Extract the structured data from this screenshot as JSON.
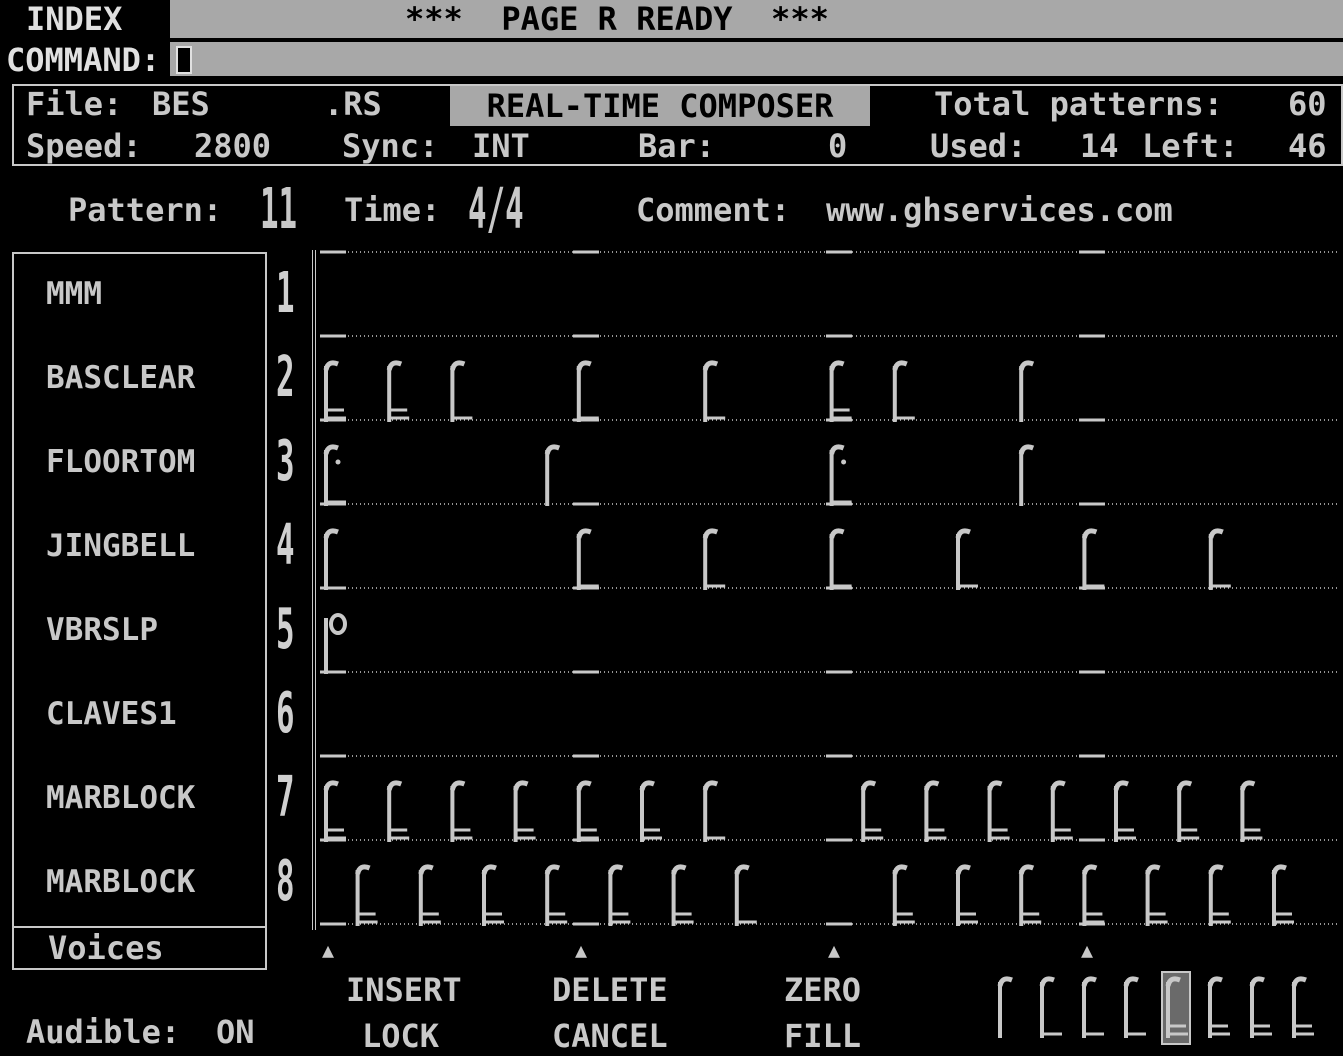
{
  "header": {
    "index_label": "INDEX",
    "status_title": "***  PAGE R READY  ***",
    "command_label": "COMMAND:"
  },
  "info": {
    "file_label": "File:",
    "file_name": "BES",
    "file_ext": ".RS",
    "mode_title": "REAL-TIME COMPOSER",
    "total_label": "Total patterns:",
    "total_value": "60",
    "speed_label": "Speed:",
    "speed_value": "2800",
    "sync_label": "Sync:",
    "sync_value": "INT",
    "bar_label": "Bar:",
    "bar_value": "0",
    "used_label": "Used:",
    "used_value": "14",
    "left_label": "Left:",
    "left_value": "46"
  },
  "pattern_row": {
    "pattern_label": "Pattern:",
    "pattern_value": "11",
    "time_label": "Time:",
    "time_value": "4/4",
    "comment_label": "Comment:",
    "comment_value": "www.ghservices.com"
  },
  "voices": {
    "footer_label": "Voices",
    "tracks": [
      {
        "number": "1",
        "name": "MMM"
      },
      {
        "number": "2",
        "name": "BASCLEAR"
      },
      {
        "number": "3",
        "name": "FLOORTOM"
      },
      {
        "number": "4",
        "name": "JINGBELL"
      },
      {
        "number": "5",
        "name": "VBRSLP"
      },
      {
        "number": "6",
        "name": "CLAVES1"
      },
      {
        "number": "7",
        "name": "MARBLOCK"
      },
      {
        "number": "8",
        "name": "MARBLOCK"
      }
    ]
  },
  "notes": {
    "track2": [
      {
        "pos": 0,
        "v": "s16"
      },
      {
        "pos": 2,
        "v": "s16"
      },
      {
        "pos": 4,
        "v": "e"
      },
      {
        "pos": 8,
        "v": "e"
      },
      {
        "pos": 12,
        "v": "e"
      },
      {
        "pos": 16,
        "v": "s16"
      },
      {
        "pos": 18,
        "v": "e"
      },
      {
        "pos": 22,
        "v": "q"
      }
    ],
    "track3": [
      {
        "pos": 0,
        "v": "ed"
      },
      {
        "pos": 7,
        "v": "q"
      },
      {
        "pos": 16,
        "v": "ed"
      },
      {
        "pos": 22,
        "v": "q"
      }
    ],
    "track4": [
      {
        "pos": 0,
        "v": "q"
      },
      {
        "pos": 8,
        "v": "e"
      },
      {
        "pos": 12,
        "v": "e"
      },
      {
        "pos": 16,
        "v": "e"
      },
      {
        "pos": 20,
        "v": "e"
      },
      {
        "pos": 24,
        "v": "e"
      },
      {
        "pos": 28,
        "v": "e"
      }
    ],
    "track5": [
      {
        "pos": 0,
        "v": "w"
      }
    ],
    "track7": [
      {
        "pos": 0,
        "v": "s16"
      },
      {
        "pos": 2,
        "v": "s16"
      },
      {
        "pos": 4,
        "v": "s16"
      },
      {
        "pos": 6,
        "v": "s16"
      },
      {
        "pos": 8,
        "v": "s16"
      },
      {
        "pos": 10,
        "v": "s16"
      },
      {
        "pos": 12,
        "v": "e"
      },
      {
        "pos": 17,
        "v": "s16"
      },
      {
        "pos": 19,
        "v": "s16"
      },
      {
        "pos": 21,
        "v": "s16"
      },
      {
        "pos": 23,
        "v": "s16"
      },
      {
        "pos": 25,
        "v": "s16"
      },
      {
        "pos": 27,
        "v": "s16"
      },
      {
        "pos": 29,
        "v": "s16"
      }
    ],
    "track8": [
      {
        "pos": 1,
        "v": "s16"
      },
      {
        "pos": 3,
        "v": "s16"
      },
      {
        "pos": 5,
        "v": "s16"
      },
      {
        "pos": 7,
        "v": "s16"
      },
      {
        "pos": 9,
        "v": "s16"
      },
      {
        "pos": 11,
        "v": "s16"
      },
      {
        "pos": 13,
        "v": "e"
      },
      {
        "pos": 18,
        "v": "s16"
      },
      {
        "pos": 20,
        "v": "s16"
      },
      {
        "pos": 22,
        "v": "s16"
      },
      {
        "pos": 24,
        "v": "s16"
      },
      {
        "pos": 26,
        "v": "s16"
      },
      {
        "pos": 28,
        "v": "s16"
      },
      {
        "pos": 30,
        "v": "s16"
      }
    ]
  },
  "footer": {
    "audible_label": "Audible:",
    "audible_value": "ON",
    "insert_label": "INSERT",
    "lock_label": "LOCK",
    "delete_label": "DELETE",
    "cancel_label": "CANCEL",
    "zero_label": "ZERO",
    "fill_label": "FILL",
    "note_palette": [
      "q",
      "e",
      "e2",
      "ed",
      "s16",
      "s16b",
      "t32",
      "t32b"
    ],
    "selected_note_index": 4
  }
}
